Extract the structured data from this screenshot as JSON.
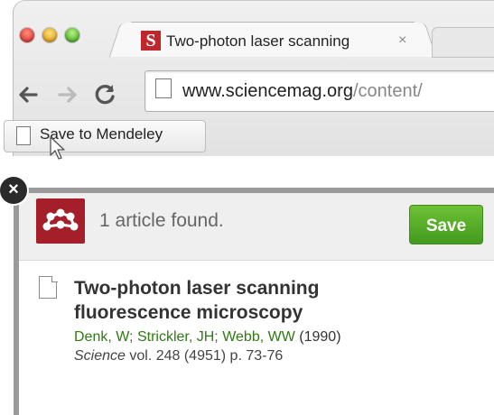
{
  "browser": {
    "tab_title": "Two-photon laser scanning",
    "tab_close": "×",
    "favicon_letter": "S",
    "url_host": "www.sciencemag.org",
    "url_rest": "/content/",
    "bookmarklet_label": "Save to Mendeley"
  },
  "popup": {
    "close_label": "×",
    "found_text": "1 article found.",
    "save_label": "Save",
    "article": {
      "title": "Two-photon laser scanning fluorescence microscopy",
      "authors": [
        "Denk, W;",
        "Strickler, JH;",
        "Webb, WW"
      ],
      "year": "(1990)",
      "journal": "Science",
      "details": " vol. 248 (4951) p. 73-76"
    }
  },
  "colors": {
    "mendeley_red": "#a51f2b",
    "save_green": "#55ad28",
    "author_green": "#2f7a14"
  }
}
